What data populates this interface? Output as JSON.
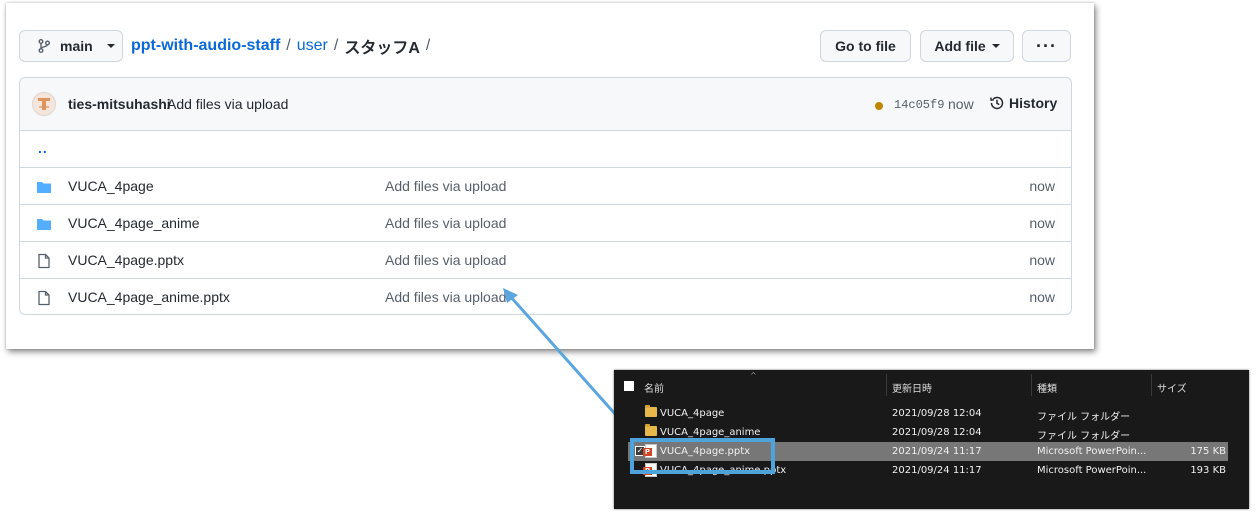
{
  "github": {
    "branch": "main",
    "breadcrumb": {
      "repo": "ppt-with-audio-staff",
      "folder": "user",
      "current": "スタッフA",
      "separator": "/"
    },
    "buttons": {
      "go_to_file": "Go to file",
      "add_file": "Add file",
      "more": "···"
    },
    "commit": {
      "author": "ties-mitsuhashi",
      "message": "Add files via upload",
      "sha": "14c05f9",
      "time": "now",
      "history_label": "History",
      "status_color": "#bf8700"
    },
    "parent_dir": "..",
    "files": [
      {
        "name": "VUCA_4page",
        "type": "folder",
        "message": "Add files via upload",
        "age": "now"
      },
      {
        "name": "VUCA_4page_anime",
        "type": "folder",
        "message": "Add files via upload",
        "age": "now"
      },
      {
        "name": "VUCA_4page.pptx",
        "type": "file",
        "message": "Add files via upload",
        "age": "now"
      },
      {
        "name": "VUCA_4page_anime.pptx",
        "type": "file",
        "message": "Add files via upload",
        "age": "now"
      }
    ],
    "colors": {
      "link": "#0969da",
      "folder_icon": "#54aeff",
      "border": "#d0d7de"
    }
  },
  "explorer": {
    "columns": {
      "name": "名前",
      "modified": "更新日時",
      "type": "種類",
      "size": "サイズ"
    },
    "rows": [
      {
        "name": "VUCA_4page",
        "modified": "2021/09/28 12:04",
        "type": "ファイル フォルダー",
        "size": ""
      },
      {
        "name": "VUCA_4page_anime",
        "modified": "2021/09/28 12:04",
        "type": "ファイル フォルダー",
        "size": ""
      },
      {
        "name": "VUCA_4page.pptx",
        "modified": "2021/09/24 11:17",
        "type": "Microsoft PowerPoin...",
        "size": "175 KB"
      },
      {
        "name": "VUCA_4page_anime.pptx",
        "modified": "2021/09/24 11:17",
        "type": "Microsoft PowerPoin...",
        "size": "193 KB"
      }
    ],
    "selected_row": "VUCA_4page.pptx",
    "colors": {
      "background": "#191919",
      "selected": "#777777",
      "highlight_box": "#4fa3dd"
    }
  }
}
